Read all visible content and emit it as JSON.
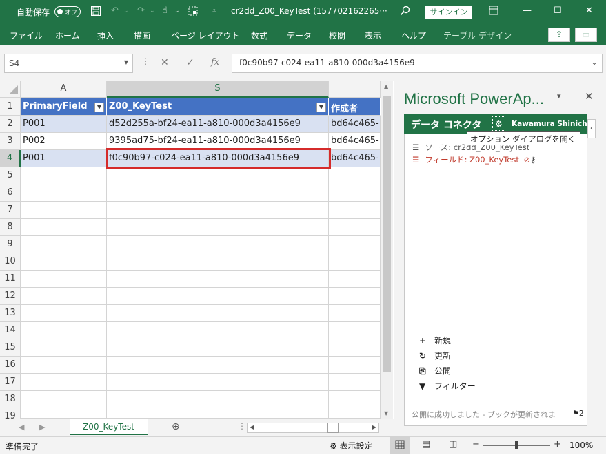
{
  "titlebar": {
    "autosave_label": "自動保存",
    "autosave_state": "オフ",
    "filename": "cr2dd_Z00_KeyTest (157702162265···",
    "signin": "サインイン"
  },
  "ribbon": {
    "tabs": [
      "ファイル",
      "ホーム",
      "挿入",
      "描画",
      "ページ レイアウト",
      "数式",
      "データ",
      "校閲",
      "表示",
      "ヘルプ"
    ],
    "special_tab": "テーブル デザイン"
  },
  "formula_bar": {
    "name_box": "S4",
    "fx": "fx",
    "formula": "f0c90b97-c024-ea11-a810-000d3a4156e9"
  },
  "grid": {
    "columns": [
      "A",
      "S"
    ],
    "rows": [
      "1",
      "2",
      "3",
      "4",
      "5",
      "6",
      "7",
      "8",
      "9",
      "10",
      "11",
      "12",
      "13",
      "14",
      "15",
      "16",
      "17",
      "18",
      "19"
    ],
    "headers": [
      "PrimaryField",
      "Z00_KeyTest",
      "作成者"
    ],
    "data": [
      [
        "P001",
        "d52d255a-bf24-ea11-a810-000d3a4156e9",
        "bd64c465-"
      ],
      [
        "P002",
        "9395ad75-bf24-ea11-a810-000d3a4156e9",
        "bd64c465-"
      ],
      [
        "P001",
        "f0c90b97-c024-ea11-a810-000d3a4156e9",
        "bd64c465-"
      ]
    ]
  },
  "sheet": {
    "tab": "Z00_KeyTest"
  },
  "status": {
    "ready": "準備完了",
    "display_settings": "表示設定",
    "zoom": "100%"
  },
  "pane": {
    "title": "Microsoft PowerAp...",
    "connector_label": "データ コネクタ",
    "user": "Kawamura Shinichi",
    "tooltip": "オプション ダイアログを開く",
    "source": "ソース: cr2dd_Z00_KeyTest",
    "field": "フィールド: Z00_KeyTest",
    "actions": [
      "新規",
      "更新",
      "公開",
      "フィルター"
    ],
    "status_msg": "公開に成功しました - ブックが更新されま",
    "flag_count": "2"
  },
  "colors": {
    "excel_green": "#217346",
    "table_header": "#4472c4",
    "band": "#d9e1f2",
    "selection_red": "#d52b2b",
    "field_red": "#c0392b"
  }
}
